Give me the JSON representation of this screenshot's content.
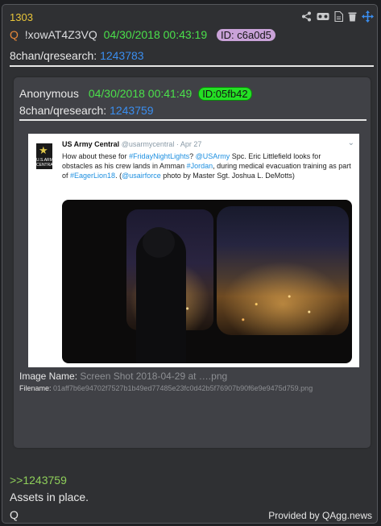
{
  "post": {
    "number": "1303",
    "q_marker": "Q",
    "tripcode": "!xowAT4Z3VQ",
    "datetime": "04/30/2018 00:43:19",
    "id_label": "ID: c6a0d5",
    "board": "8chan/qresearch:",
    "board_link": "1243783",
    "reply_ref": ">>1243759",
    "message_line1": "Assets in place.",
    "message_line2": "Q",
    "credit": "Provided by QAgg.news"
  },
  "toolbar": {
    "icons": [
      "share-icon",
      "vr-goggles-icon",
      "document-icon",
      "trash-icon",
      "move-icon"
    ]
  },
  "quoted": {
    "author": "Anonymous",
    "datetime": "04/30/2018 00:41:49",
    "id_label": "ID:05fb42",
    "board": "8chan/qresearch:",
    "board_link": "1243759",
    "image_name_label": "Image Name:",
    "image_name": "Screen Shot 2018-04-29 at ….png",
    "filename_label": "Filename:",
    "filename": "01aff7b6e94702f7527b1b49ed77485e23fc0d42b5f76907b90f6e9e9475d759.png"
  },
  "tweet": {
    "name": "US Army Central",
    "handle": "@usarmycentral · Apr 27",
    "logo_text": "U.S.ARMY CENTRAL",
    "text_1": "How about these for ",
    "tag_1": "#FridayNightLights",
    "text_2": "? ",
    "tag_2": "@USArmy",
    "text_3": " Spc. Eric Littlefield looks for obstacles as his crew lands in Amman ",
    "tag_3": "#Jordan",
    "text_4": ", during medical evacuation training as part of ",
    "tag_4": "#EagerLion18",
    "text_5": ". (",
    "tag_5": "@usairforce",
    "text_6": " photo by Master Sgt. Joshua L. DeMotts)"
  },
  "colors": {
    "post_number": "#e8c53a",
    "date": "#4be04b",
    "link": "#3a8ef0",
    "id_badge": "#c9a2d8",
    "id_badge_quoted": "#24e024",
    "greentext": "#8fcf5a"
  }
}
